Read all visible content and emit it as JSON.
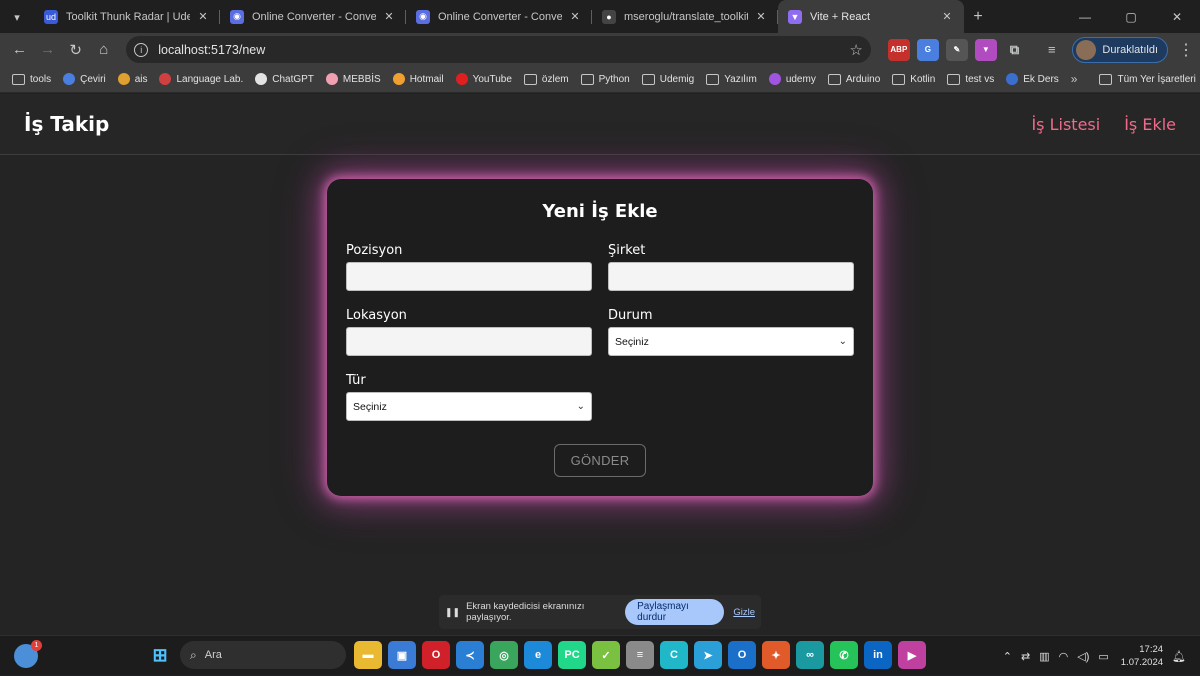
{
  "browser": {
    "tabs": [
      {
        "title": "Toolkit Thunk Radar | Udemig",
        "favicon_color": "#3a5bd9",
        "favicon_glyph": "ud",
        "active": false
      },
      {
        "title": "Online Converter - Convert Ima",
        "favicon_color": "#5b6ee1",
        "favicon_glyph": "◉",
        "active": false
      },
      {
        "title": "Online Converter - Convert Ima",
        "favicon_color": "#5b6ee1",
        "favicon_glyph": "◉",
        "active": false
      },
      {
        "title": "mseroglu/translate_toolkit_thu",
        "favicon_color": "#444444",
        "favicon_glyph": "●",
        "active": false
      },
      {
        "title": "Vite + React",
        "favicon_color": "#8f6df0",
        "favicon_glyph": "▼",
        "active": true
      }
    ],
    "url": "localhost:5173/new",
    "profile_label": "Duraklatıldı",
    "extensions": [
      {
        "name": "adblock-icon",
        "glyph": "ABP",
        "color": "#c4302b"
      },
      {
        "name": "translate-icon",
        "glyph": "G",
        "color": "#4a7fe0"
      },
      {
        "name": "puzzle-ext-icon",
        "glyph": "✎",
        "color": "#555555"
      },
      {
        "name": "vite-ext-icon",
        "glyph": "▼",
        "color": "#b04cc0"
      }
    ],
    "bookmarks": [
      {
        "label": "tools",
        "kind": "folder",
        "color": "#c4c7c5"
      },
      {
        "label": "Çeviri",
        "kind": "dot",
        "color": "#4a7fe0"
      },
      {
        "label": "ais",
        "kind": "dot",
        "color": "#e0a030"
      },
      {
        "label": "Language Lab.",
        "kind": "dot",
        "color": "#d04040"
      },
      {
        "label": "ChatGPT",
        "kind": "dot",
        "color": "#e3e3e3"
      },
      {
        "label": "MEBBİS",
        "kind": "dot",
        "color": "#f0a0b0"
      },
      {
        "label": "Hotmail",
        "kind": "dot",
        "color": "#f0a030"
      },
      {
        "label": "YouTube",
        "kind": "dot",
        "color": "#e02020"
      },
      {
        "label": "özlem",
        "kind": "folder",
        "color": "#c4c7c5"
      },
      {
        "label": "Python",
        "kind": "folder",
        "color": "#c4c7c5"
      },
      {
        "label": "Udemig",
        "kind": "folder",
        "color": "#c4c7c5"
      },
      {
        "label": "Yazılım",
        "kind": "folder",
        "color": "#c4c7c5"
      },
      {
        "label": "udemy",
        "kind": "dot",
        "color": "#a055e0"
      },
      {
        "label": "Arduino",
        "kind": "folder",
        "color": "#c4c7c5"
      },
      {
        "label": "Kotlin",
        "kind": "folder",
        "color": "#c4c7c5"
      },
      {
        "label": "test vs",
        "kind": "folder",
        "color": "#c4c7c5"
      },
      {
        "label": "Ek Ders",
        "kind": "dot",
        "color": "#3a6fd0"
      }
    ],
    "bookmarks_more": "»",
    "all_bookmarks": "Tüm Yer İşaretleri"
  },
  "app": {
    "brand": "İş Takip",
    "nav": {
      "list": "İş Listesi",
      "add": "İş Ekle"
    },
    "accent_color": "#f06a8a",
    "form": {
      "title": "Yeni İş Ekle",
      "position_label": "Pozisyon",
      "position_value": "",
      "company_label": "Şirket",
      "company_value": "",
      "location_label": "Lokasyon",
      "location_value": "",
      "status_label": "Durum",
      "status_selected": "Seçiniz",
      "type_label": "Tür",
      "type_selected": "Seçiniz",
      "submit_label": "GÖNDER"
    }
  },
  "share_bar": {
    "message": "Ekran kaydedicisi ekranınızı paylaşıyor.",
    "stop_label": "Paylaşmayı durdur",
    "hide_label": "Gizle"
  },
  "taskbar": {
    "search_placeholder": "Ara",
    "weather_badge": "1",
    "apps": [
      {
        "name": "file-explorer-icon",
        "glyph": "▬",
        "color": "#e8b931"
      },
      {
        "name": "store-icon",
        "glyph": "▣",
        "color": "#3a7bd5"
      },
      {
        "name": "opera-icon",
        "glyph": "O",
        "color": "#d0202a"
      },
      {
        "name": "vscode-icon",
        "glyph": "≺",
        "color": "#2a7fd4"
      },
      {
        "name": "chrome-icon",
        "glyph": "◎",
        "color": "#3aa55c"
      },
      {
        "name": "edge-icon",
        "glyph": "e",
        "color": "#1c8ad8"
      },
      {
        "name": "pycharm-icon",
        "glyph": "PC",
        "color": "#21d789"
      },
      {
        "name": "chat-app-icon",
        "glyph": "✓",
        "color": "#7ac142"
      },
      {
        "name": "database-icon",
        "glyph": "≡",
        "color": "#8a8a8a"
      },
      {
        "name": "canva-icon",
        "glyph": "C",
        "color": "#20b8c8"
      },
      {
        "name": "telegram-icon",
        "glyph": "➤",
        "color": "#2a9fd8"
      },
      {
        "name": "outlook-icon",
        "glyph": "O",
        "color": "#1a6fc8"
      },
      {
        "name": "xmind-icon",
        "glyph": "✦",
        "color": "#e05a2a"
      },
      {
        "name": "arduino-icon",
        "glyph": "∞",
        "color": "#1a9aa0"
      },
      {
        "name": "whatsapp-icon",
        "glyph": "✆",
        "color": "#25c35a"
      },
      {
        "name": "linkedin-icon",
        "glyph": "in",
        "color": "#0a66c2"
      },
      {
        "name": "recorder-icon",
        "glyph": "▶",
        "color": "#c040a0"
      }
    ],
    "time": "17:24",
    "date": "1.07.2024"
  }
}
